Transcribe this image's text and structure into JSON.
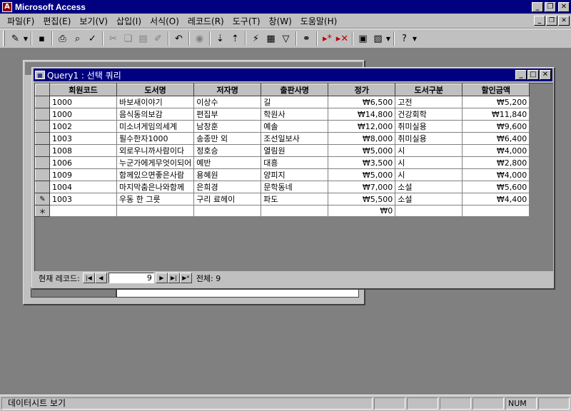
{
  "app": {
    "title": "Microsoft Access"
  },
  "menu": [
    "파일(F)",
    "편집(E)",
    "보기(V)",
    "삽입(I)",
    "서식(O)",
    "레코드(R)",
    "도구(T)",
    "창(W)",
    "도움말(H)"
  ],
  "toolbar": {
    "icons": [
      "view-icon",
      "save-icon",
      "print-icon",
      "print-preview-icon",
      "spelling-icon",
      "cut-icon",
      "copy-icon",
      "paste-icon",
      "format-painter-icon",
      "undo-icon",
      "hyperlink-icon",
      "sort-ascending-icon",
      "sort-descending-icon",
      "filter-by-selection-icon",
      "filter-by-form-icon",
      "apply-filter-icon",
      "find-icon",
      "new-record-icon",
      "delete-record-icon",
      "database-window-icon",
      "new-object-icon",
      "help-icon"
    ]
  },
  "query_window": {
    "title": "Query1 : 선택 쿼리",
    "columns": [
      "회원코드",
      "도서명",
      "저자명",
      "출판사명",
      "정가",
      "도서구분",
      "할인금액"
    ],
    "rows": [
      [
        "1000",
        "바보새이야기",
        "이상수",
        "길",
        "₩6,500",
        "고전",
        "₩5,200"
      ],
      [
        "1000",
        "음식동의보감",
        "편집부",
        "학원사",
        "₩14,800",
        "건강회학",
        "₩11,840"
      ],
      [
        "1002",
        "미소녀게임의세계",
        "남창훈",
        "예솔",
        "₩12,000",
        "취미실용",
        "₩9,600"
      ],
      [
        "1003",
        "필수한자1000",
        "송종만 외",
        "조선일보사",
        "₩8,000",
        "취미실용",
        "₩6,400"
      ],
      [
        "1008",
        "외로우니까사람이다",
        "정호승",
        "열림원",
        "₩5,000",
        "시",
        "₩4,000"
      ],
      [
        "1006",
        "누군가에게무엇이되어",
        "예반",
        "대흥",
        "₩3,500",
        "시",
        "₩2,800"
      ],
      [
        "1009",
        "함께있으면좋은사람",
        "용혜원",
        "양피지",
        "₩5,000",
        "시",
        "₩4,000"
      ],
      [
        "1004",
        "마지막춤은나와함께",
        "은희경",
        "문학동네",
        "₩7,000",
        "소설",
        "₩5,600"
      ],
      [
        "1003",
        "우동 한 그릇",
        "구리 료헤이",
        "파도",
        "₩5,500",
        "소설",
        "₩4,400"
      ]
    ],
    "new_row_price": "₩0",
    "edit_marker": "✎",
    "new_marker": "＊"
  },
  "navigation": {
    "label": "현재 레코드:",
    "current": "9",
    "total_label": "전체: 9"
  },
  "statusbar": {
    "text": "데이터시트 보기",
    "num": "NUM"
  }
}
